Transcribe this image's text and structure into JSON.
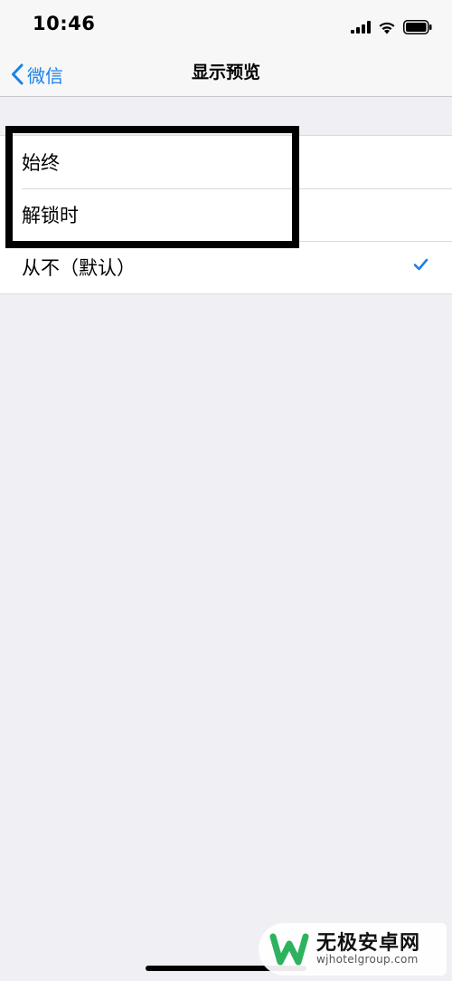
{
  "status_bar": {
    "time": "10:46"
  },
  "nav": {
    "back_label": "微信",
    "title": "显示预览"
  },
  "list": {
    "items": [
      {
        "label": "始终",
        "checked": false
      },
      {
        "label": "解锁时",
        "checked": false
      },
      {
        "label": "从不（默认）",
        "checked": true
      }
    ]
  },
  "colors": {
    "accent": "#1a82e8",
    "background": "#efeff4",
    "watermark_green": "#2db35d"
  },
  "watermark": {
    "name": "无极安卓网",
    "url": "wjhotelgroup.com"
  }
}
